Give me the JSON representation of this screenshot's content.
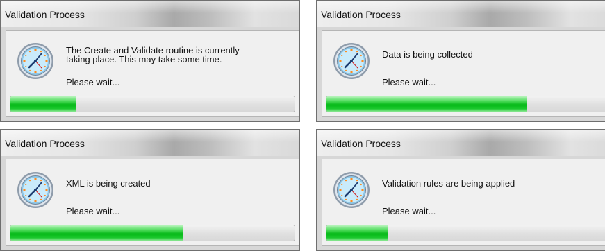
{
  "dialogs": [
    {
      "title": "Validation Process",
      "message": "The Create and Validate routine is currently\ntaking place. This may take some time.",
      "wait_text": "Please wait...",
      "progress": 0.23
    },
    {
      "title": "Validation Process",
      "message": "Data is being collected",
      "wait_text": "Please wait...",
      "progress": 0.69
    },
    {
      "title": "Validation Process",
      "message": "XML is being created",
      "wait_text": "Please wait...",
      "progress": 0.61
    },
    {
      "title": "Validation Process",
      "message": "Validation rules are being applied",
      "wait_text": "Please wait...",
      "progress": 0.21
    }
  ],
  "icon": "clock-icon",
  "colors": {
    "progress_green": "#06b918",
    "clock_face": "#bfe3f7",
    "clock_rim": "#7a8da0"
  }
}
